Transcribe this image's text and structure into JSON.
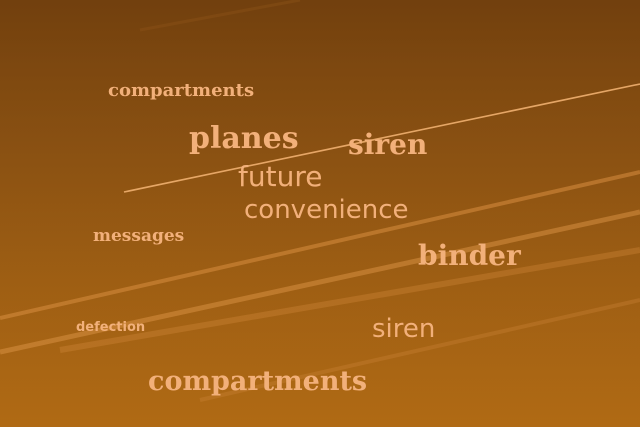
{
  "words": [
    {
      "text": "compartments"
    },
    {
      "text": "planes"
    },
    {
      "text": "siren"
    },
    {
      "text": "future"
    },
    {
      "text": "convenience"
    },
    {
      "text": "messages"
    },
    {
      "text": "binder"
    },
    {
      "text": "defection"
    },
    {
      "text": "siren"
    },
    {
      "text": "compartments"
    }
  ],
  "colors": {
    "sky_top": "#7a4510",
    "sky_bottom": "#b06a14",
    "text": "#f2b07a",
    "contrail": "#e9a25a"
  }
}
